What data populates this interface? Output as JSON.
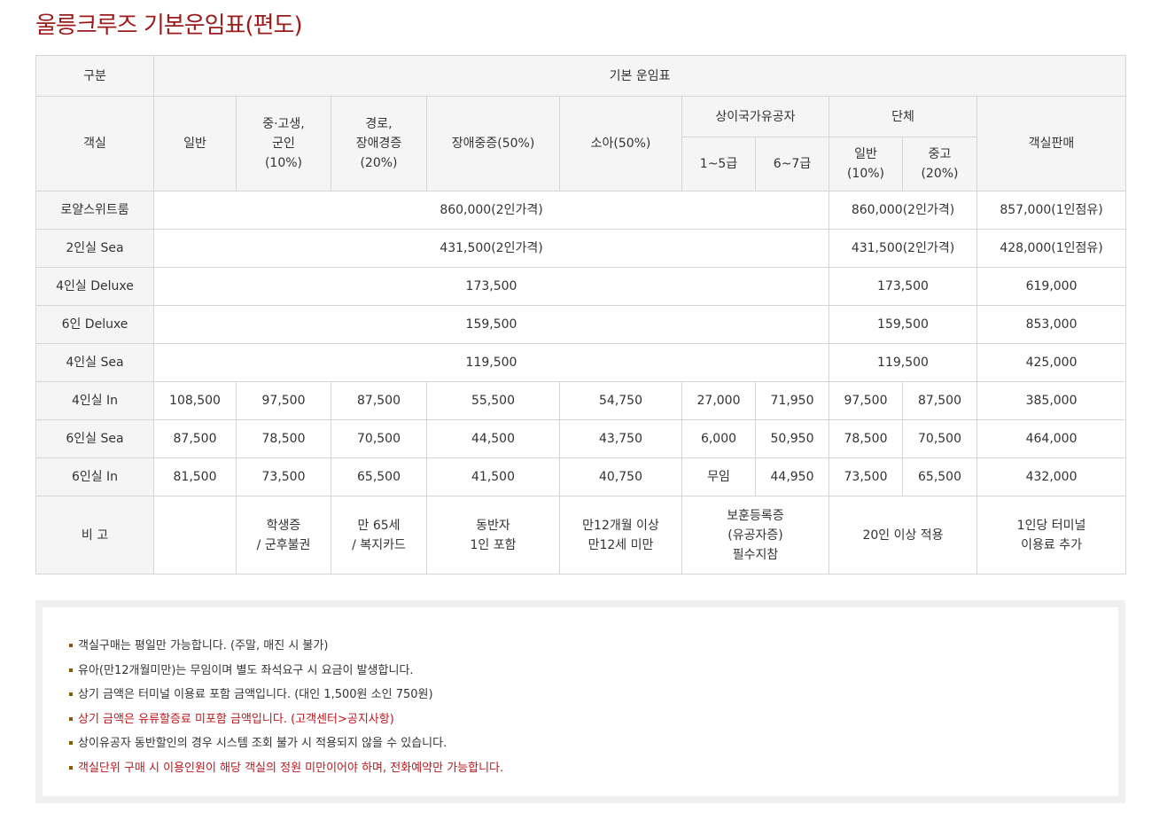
{
  "title": "울릉크루즈 기본운임표(편도)",
  "table": {
    "head": {
      "category": "구분",
      "base_fare": "기본 운임표",
      "cabin": "객실",
      "general": "일반",
      "student": "중·고생,\n군인\n(10%)",
      "senior": "경로,\n장애경증\n(20%)",
      "disabled_severe": "장애중증(50%)",
      "child": "소아(50%)",
      "veterans": "상이국가유공자",
      "veterans_1_5": "1~5급",
      "veterans_6_7": "6~7급",
      "group": "단체",
      "group_general": "일반\n(10%)",
      "group_student": "중고\n(20%)",
      "cabin_sale": "객실판매"
    },
    "merged_rows": [
      {
        "cabin": "로얄스위트룸",
        "fare": "860,000(2인가격)",
        "group": "860,000(2인가격)",
        "sale": "857,000(1인점유)"
      },
      {
        "cabin": "2인실 Sea",
        "fare": "431,500(2인가격)",
        "group": "431,500(2인가격)",
        "sale": "428,000(1인점유)"
      },
      {
        "cabin": "4인실 Deluxe",
        "fare": "173,500",
        "group": "173,500",
        "sale": "619,000"
      },
      {
        "cabin": "6인 Deluxe",
        "fare": "159,500",
        "group": "159,500",
        "sale": "853,000"
      },
      {
        "cabin": "4인실 Sea",
        "fare": "119,500",
        "group": "119,500",
        "sale": "425,000"
      }
    ],
    "full_rows": [
      {
        "cabin": "4인실 In",
        "general": "108,500",
        "student": "97,500",
        "senior": "87,500",
        "disabled": "55,500",
        "child": "54,750",
        "v15": "27,000",
        "v67": "71,950",
        "g_general": "97,500",
        "g_student": "87,500",
        "sale": "385,000"
      },
      {
        "cabin": "6인실 Sea",
        "general": "87,500",
        "student": "78,500",
        "senior": "70,500",
        "disabled": "44,500",
        "child": "43,750",
        "v15": "6,000",
        "v67": "50,950",
        "g_general": "78,500",
        "g_student": "70,500",
        "sale": "464,000"
      },
      {
        "cabin": "6인실 In",
        "general": "81,500",
        "student": "73,500",
        "senior": "65,500",
        "disabled": "41,500",
        "child": "40,750",
        "v15": "무임",
        "v67": "44,950",
        "g_general": "73,500",
        "g_student": "65,500",
        "sale": "432,000"
      }
    ],
    "remarks": {
      "label": "비 고",
      "general": "",
      "student": "학생증\n/ 군후불권",
      "senior": "만 65세\n/ 복지카드",
      "disabled": "동반자\n1인 포함",
      "child": "만12개월 이상\n만12세 미만",
      "veterans": "보훈등록증\n(유공자증)\n필수지참",
      "group": "20인 이상 적용",
      "sale": "1인당 터미널\n이용료 추가"
    }
  },
  "notes": [
    {
      "text": "객실구매는 평일만 가능합니다. (주말, 매진 시 불가)",
      "highlight": false
    },
    {
      "text": "유아(만12개월미만)는 무임이며 별도 좌석요구 시 요금이 발생합니다.",
      "highlight": false
    },
    {
      "text": "상기 금액은 터미널 이용료 포함 금액입니다. (대인 1,500원 소인 750원)",
      "highlight": false
    },
    {
      "text": "상기 금액은 유류할증료 미포함 금액입니다. (고객센터>공지사항)",
      "highlight": true
    },
    {
      "text": "상이유공자 동반할인의 경우 시스템 조회 불가 시 적용되지 않을 수 있습니다.",
      "highlight": false
    },
    {
      "text": "객실단위 구매 시 이용인원이 해당 객실의 정원 미만이어야 하며, 전화예약만 가능합니다.",
      "highlight": true
    }
  ],
  "colors": {
    "title": "#9b1b1b",
    "highlight_text": "#c0161c",
    "bullet": "#8b5a00",
    "header_bg": "#f5f5f5",
    "border": "#d6d6d6"
  }
}
